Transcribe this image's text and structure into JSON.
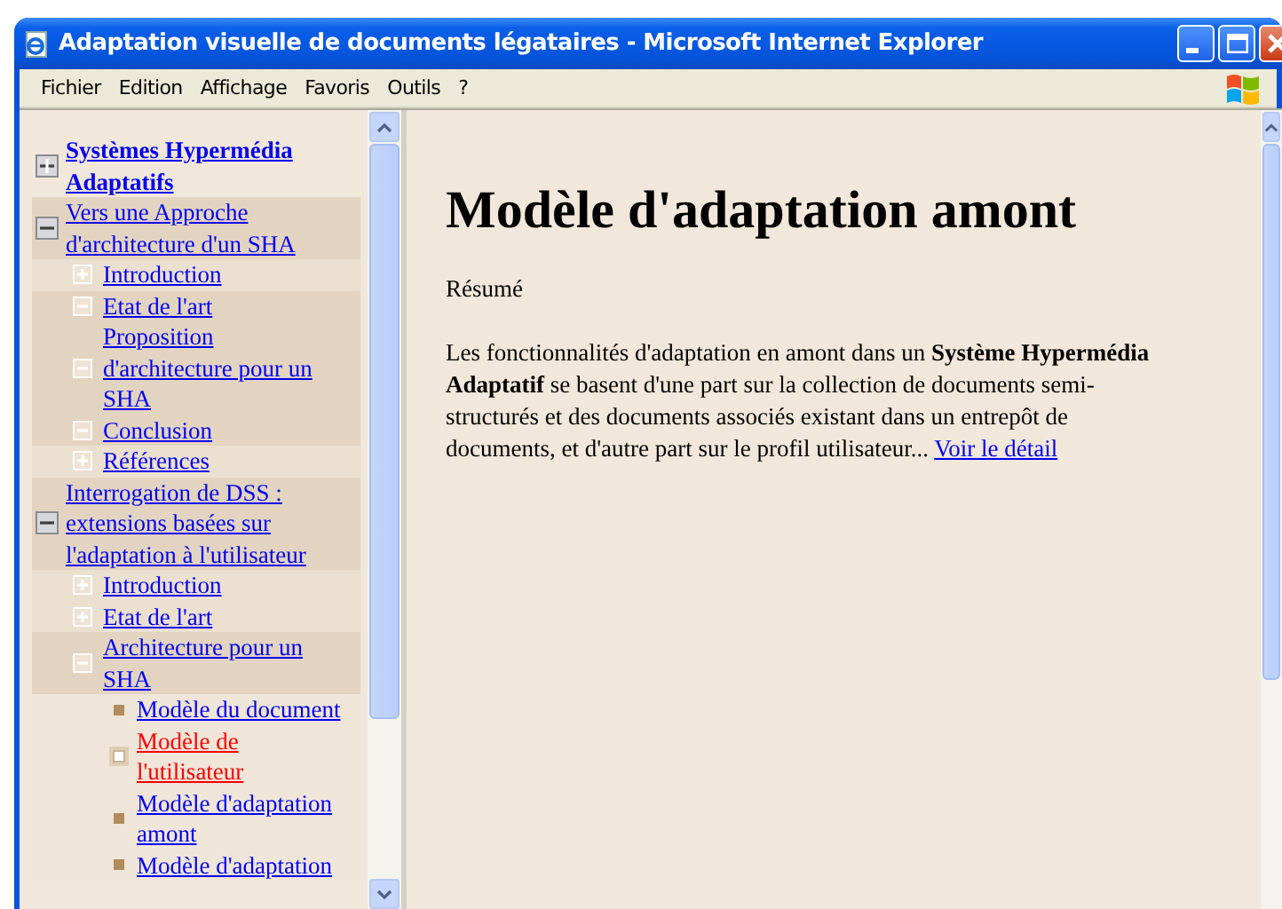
{
  "window": {
    "title": "Adaptation visuelle de documents légataires - Microsoft Internet Explorer"
  },
  "menu": [
    "Fichier",
    "Edition",
    "Affichage",
    "Favoris",
    "Outils",
    "?"
  ],
  "tree": [
    {
      "label": "Systèmes Hypermédia Adaptatifs",
      "bold": true,
      "expanded": false,
      "selected": false
    },
    {
      "label": "Vers une Approche d'architecture d'un SHA",
      "bold": false,
      "expanded": true,
      "selected": false,
      "children": [
        {
          "label": "Introduction",
          "expanded": false,
          "selected": false
        },
        {
          "label": "Etat de l'art",
          "expanded": true,
          "selected": false
        },
        {
          "label": "Proposition d'architecture pour un SHA",
          "expanded": true,
          "selected": false
        },
        {
          "label": "Conclusion",
          "expanded": true,
          "selected": false
        },
        {
          "label": "Références",
          "expanded": false,
          "selected": false
        }
      ]
    },
    {
      "label": "Interrogation de DSS : extensions basées sur l'adaptation à l'utilisateur",
      "bold": false,
      "expanded": true,
      "selected": false,
      "children": [
        {
          "label": "Introduction",
          "expanded": false,
          "selected": false
        },
        {
          "label": "Etat de l'art",
          "expanded": false,
          "selected": false
        },
        {
          "label": "Architecture pour un SHA",
          "expanded": true,
          "selected": false,
          "children": [
            {
              "label": "Modèle du document",
              "selected": false
            },
            {
              "label": "Modèle de l'utilisateur",
              "selected": true
            },
            {
              "label": "Modèle d'adaptation amont",
              "selected": false
            },
            {
              "label": "Modèle d'adaptation",
              "selected": false
            }
          ]
        }
      ]
    }
  ],
  "page": {
    "heading": "Modèle d'adaptation amont",
    "subtitle": "Résumé",
    "paragraph": "Les fonctionnalités d'adaptation en amont dans un **Système Hypermédia Adaptatif** se basent d'une part sur la collection de documents semi-structurés et des documents associés existant dans un entrepôt de documents, et d'autre part sur le profil utilisateur...",
    "link": "Voir le détail"
  }
}
